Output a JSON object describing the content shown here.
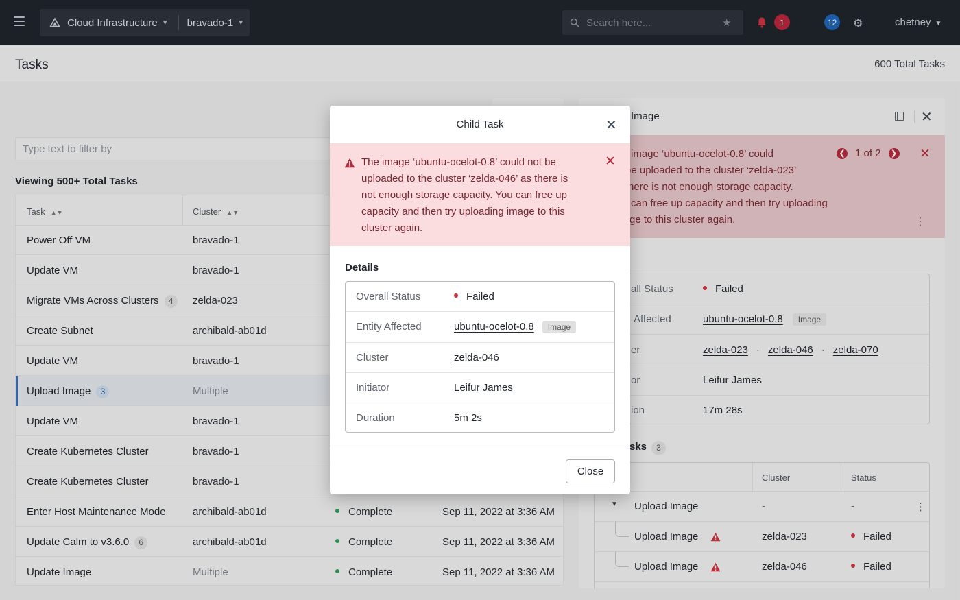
{
  "topbar": {
    "app_name": "Cloud Infrastructure",
    "cluster_name": "bravado-1",
    "search_placeholder": "Search here...",
    "alert_count": "1",
    "task_count": "12",
    "username": "chetney"
  },
  "page": {
    "title": "Tasks",
    "total": "600 Total Tasks"
  },
  "filter": {
    "placeholder": "Type text to filter by"
  },
  "list": {
    "viewing_label": "Viewing 500+ Total Tasks",
    "columns": {
      "task": "Task",
      "cluster": "Cluster"
    },
    "rows": [
      {
        "task": "Power Off VM",
        "count": "",
        "cluster": "bravado-1",
        "status": "",
        "date": ""
      },
      {
        "task": "Update VM",
        "count": "",
        "cluster": "bravado-1",
        "status": "",
        "date": ""
      },
      {
        "task": "Migrate VMs Across Clusters",
        "count": "4",
        "cluster": "zelda-023",
        "status": "",
        "date": ""
      },
      {
        "task": "Create Subnet",
        "count": "",
        "cluster": "archibald-ab01d",
        "status": "",
        "date": ""
      },
      {
        "task": "Update VM",
        "count": "",
        "cluster": "bravado-1",
        "status": "",
        "date": ""
      },
      {
        "task": "Upload Image",
        "count": "3",
        "cluster": "Multiple",
        "status": "",
        "date": ""
      },
      {
        "task": "Update VM",
        "count": "",
        "cluster": "bravado-1",
        "status": "",
        "date": ""
      },
      {
        "task": "Create Kubernetes Cluster",
        "count": "",
        "cluster": "bravado-1",
        "status": "",
        "date": ""
      },
      {
        "task": "Create Kubernetes Cluster",
        "count": "",
        "cluster": "bravado-1",
        "status": "",
        "date": ""
      },
      {
        "task": "Enter Host Maintenance Mode",
        "count": "",
        "cluster": "archibald-ab01d",
        "status": "Complete",
        "date": "Sep 11, 2022 at 3:36 AM"
      },
      {
        "task": "Update Calm to v3.6.0",
        "count": "6",
        "cluster": "archibald-ab01d",
        "status": "Complete",
        "date": "Sep 11, 2022 at 3:36 AM"
      },
      {
        "task": "Update Image",
        "count": "",
        "cluster": "Multiple",
        "status": "Complete",
        "date": "Sep 11, 2022 at 3:36 AM"
      }
    ]
  },
  "detail_panel": {
    "title": "Image",
    "alert_message": "image 'ubuntu-ocelot-0.8' could be uploaded to the cluster 'zelda-023' here is not enough storage capacity. can free up capacity and then try uploading ge to this cluster again.",
    "alert_lines": [
      "image ‘ubuntu-ocelot-0.8’ could",
      "be uploaded to the cluster ‘zelda-023’",
      "here is not enough storage capacity.",
      "can free up capacity and then try uploading",
      "ge to this cluster again."
    ],
    "pager": "1 of 2",
    "details": [
      {
        "label": "all Status",
        "value": "Failed"
      },
      {
        "label": "Affected",
        "value": "ubuntu-ocelot-0.8",
        "tag": "Image"
      },
      {
        "label": "er",
        "clusters": [
          "zelda-023",
          "zelda-046",
          "zelda-070"
        ]
      },
      {
        "label": "or",
        "value": "Leifur James"
      },
      {
        "label": "ion",
        "value": "17m 28s"
      }
    ],
    "subtasks_title": "sks",
    "subtasks_count": "3",
    "subtasks_columns": {
      "cluster": "Cluster",
      "status": "Status"
    },
    "subtasks": [
      {
        "task": "Upload Image",
        "cluster": "-",
        "status": "-"
      },
      {
        "task": "Upload Image",
        "cluster": "zelda-023",
        "status": "Failed"
      },
      {
        "task": "Upload Image",
        "cluster": "zelda-046",
        "status": "Failed"
      }
    ]
  },
  "modal": {
    "title": "Child Task",
    "alert": "The image ‘ubuntu-ocelot-0.8’ could not be uploaded to the cluster ‘zelda-046’ as there is not enough storage capacity. You can free up capacity and then try uploading image to this cluster again.",
    "details_title": "Details",
    "details": {
      "overall_status_label": "Overall Status",
      "overall_status": "Failed",
      "entity_label": "Entity Affected",
      "entity": "ubuntu-ocelot-0.8",
      "entity_tag": "Image",
      "cluster_label": "Cluster",
      "cluster": "zelda-046",
      "initiator_label": "Initiator",
      "initiator": "Leifur James",
      "duration_label": "Duration",
      "duration": "5m 2s"
    },
    "close_label": "Close"
  },
  "colors": {
    "topbar": "#1f232b",
    "alert_bg": "#fbdcdf",
    "alert_text": "#7a2a34",
    "failed": "#c9333f",
    "complete": "#2f9d5b",
    "accent": "#3a6fb0"
  },
  "icons": [
    "menu-icon",
    "cloud-icon",
    "search-icon",
    "star-icon",
    "bell-icon",
    "moon-icon",
    "gear-icon",
    "close-icon",
    "warning-icon",
    "chevron-left-icon",
    "chevron-right-icon",
    "kebab-icon",
    "panel-icon"
  ]
}
